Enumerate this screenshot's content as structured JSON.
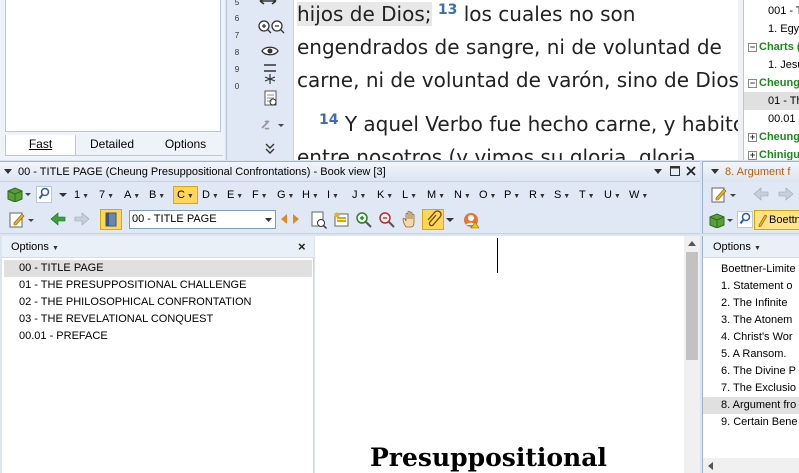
{
  "search_panel": {
    "tabs": [
      "Fast",
      "Detailed",
      "Options"
    ]
  },
  "verse_numbers": [
    "5",
    "6",
    "7",
    "8",
    "9",
    "0"
  ],
  "bible": {
    "line1_pre": "hijos de Dios;",
    "v13": "13",
    "line1_post": " los cuales no son",
    "line2": "engendrados de sangre, ni de voluntad de",
    "line3": "carne, ni de voluntad de varón, sino de Dios.",
    "v14": "14",
    "line4": " Y aquel Verbo fue hecho carne, y habitó",
    "line5": "entre nosotros (y vimos su gloria, gloria"
  },
  "right_tree": {
    "rows": [
      {
        "text": "001 - T",
        "kind": "item"
      },
      {
        "text": "1. Egy",
        "kind": "item"
      },
      {
        "text": "Charts (",
        "kind": "head"
      },
      {
        "text": "1. Jesu",
        "kind": "item"
      },
      {
        "text": "Cheung",
        "kind": "head"
      },
      {
        "text": "01 - Th",
        "kind": "sel"
      },
      {
        "text": "00.01 -",
        "kind": "item"
      },
      {
        "text": "Cheung",
        "kind": "head"
      },
      {
        "text": "Chinigu",
        "kind": "head"
      }
    ]
  },
  "book_window": {
    "title": "00 - TITLE PAGE (Cheung Presuppositional Confrontations) - Book view [3]",
    "letters": [
      "1",
      "7",
      "A",
      "B",
      "C",
      "D",
      "E",
      "F",
      "G",
      "H",
      "I",
      "J",
      "K",
      "L",
      "M",
      "N",
      "O",
      "P",
      "R",
      "S",
      "T",
      "U",
      "W"
    ],
    "active_letter": "C",
    "nav_value": "00 - TITLE PAGE",
    "toc_options": "Options",
    "toc_close": "×",
    "toc": [
      "00 - TITLE PAGE",
      "01 - THE PRESUPPOSITIONAL CHALLENGE",
      "02 - THE PHILOSOPHICAL CONFRONTATION",
      "03 - THE REVELATIONAL CONQUEST",
      "00.01 - PREFACE"
    ],
    "content_heading": "Presuppositional"
  },
  "right_panel": {
    "title": "8. Argument f",
    "resource": "Boettn",
    "options": "Options",
    "items": [
      "Boettner-Limite",
      "1.  Statement o",
      "2.  The Infinite",
      "3.  The Atonem",
      "4.  Christ's Wor",
      "5.  A Ransom.",
      "6.  The Divine P",
      "7.  The Exclusio",
      "8. Argument fro",
      "9.  Certain Bene"
    ],
    "selected_index": 8
  },
  "colors": {
    "accent_orange": "#c45a00",
    "tree_green": "#1a8b1a",
    "verse_blue": "#3b6db3",
    "active_letter": "#ffd65a"
  }
}
